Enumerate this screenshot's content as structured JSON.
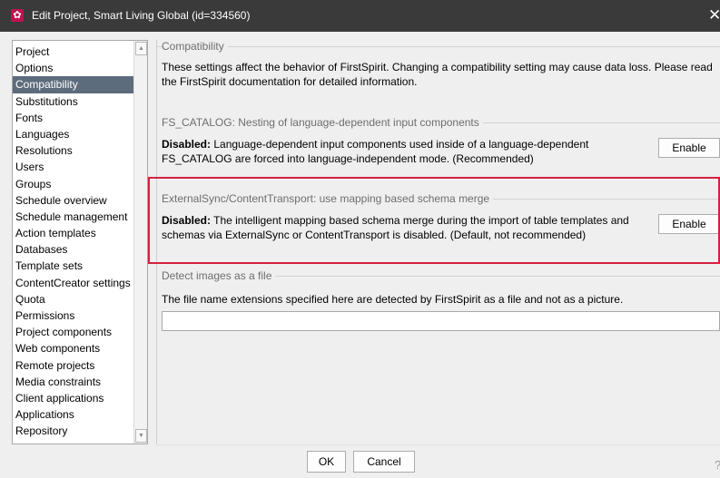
{
  "window": {
    "title": "Edit Project, Smart Living Global (id=334560)",
    "title_icon": "gear-icon",
    "close_glyph": "✕"
  },
  "sidebar": {
    "items": [
      {
        "label": "Project"
      },
      {
        "label": "Options"
      },
      {
        "label": "Compatibility",
        "selected": true
      },
      {
        "label": "Substitutions"
      },
      {
        "label": "Fonts"
      },
      {
        "label": "Languages"
      },
      {
        "label": "Resolutions"
      },
      {
        "label": "Users"
      },
      {
        "label": "Groups"
      },
      {
        "label": "Schedule overview"
      },
      {
        "label": "Schedule management"
      },
      {
        "label": "Action templates"
      },
      {
        "label": "Databases"
      },
      {
        "label": "Template sets"
      },
      {
        "label": "ContentCreator settings"
      },
      {
        "label": "Quota"
      },
      {
        "label": "Permissions"
      },
      {
        "label": "Project components"
      },
      {
        "label": "Web components"
      },
      {
        "label": "Remote projects"
      },
      {
        "label": "Media constraints"
      },
      {
        "label": "Client applications"
      },
      {
        "label": "Applications"
      },
      {
        "label": "Repository"
      }
    ]
  },
  "compat": {
    "header": "Compatibility",
    "description": "These settings affect the behavior of FirstSpirit. Changing a compatibility setting may cause data loss. Please read the FirstSpirit documentation for detailed information."
  },
  "fs_catalog": {
    "header": "FS_CATALOG: Nesting of language-dependent input components",
    "status_label": "Disabled:",
    "text": " Language-dependent input components used inside of a language-dependent FS_CATALOG are forced into language-independent mode. (Recommended)",
    "button_label": "Enable"
  },
  "external_sync": {
    "header": "ExternalSync/ContentTransport: use mapping based schema merge",
    "status_label": "Disabled:",
    "text": " The intelligent mapping based schema merge during the import of table templates and schemas via ExternalSync or ContentTransport is disabled. (Default, not recommended)",
    "button_label": "Enable"
  },
  "detect_images": {
    "header": "Detect images as a file",
    "description": "The file name extensions specified here are detected by FirstSpirit as a file and not as a picture.",
    "value": ""
  },
  "footer": {
    "ok_label": "OK",
    "cancel_label": "Cancel",
    "help_glyph": "?"
  },
  "colors": {
    "titlebar": "#3a3a3a",
    "title_icon": "#c1124f",
    "selection": "#5d6c7c",
    "highlight": "#d5203f"
  }
}
